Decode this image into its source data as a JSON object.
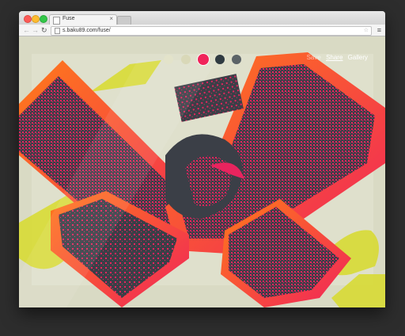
{
  "browser": {
    "tab_title": "Fuse",
    "url": "s.baku89.com/fuse/",
    "back_icon": "arrow-left-icon",
    "forward_icon": "arrow-right-icon",
    "reload_icon": "reload-icon",
    "menu_icon": "hamburger-menu-icon",
    "star_icon": "star-icon"
  },
  "palette": {
    "colors": [
      "#e3e3ca",
      "#d9d8b8",
      "#f0245a",
      "#2f3a41",
      "#5b6367"
    ],
    "selected_index": 2
  },
  "links": {
    "save_label": "Save",
    "share_label": "Share",
    "gallery_label": "Gallery"
  },
  "artwork": {
    "background": "#d9dac4",
    "blob_color": "#d8db3c",
    "band_color": "#3b3f47",
    "pixel_color": "#e8245e",
    "glow_color": "#ff6a1c"
  }
}
